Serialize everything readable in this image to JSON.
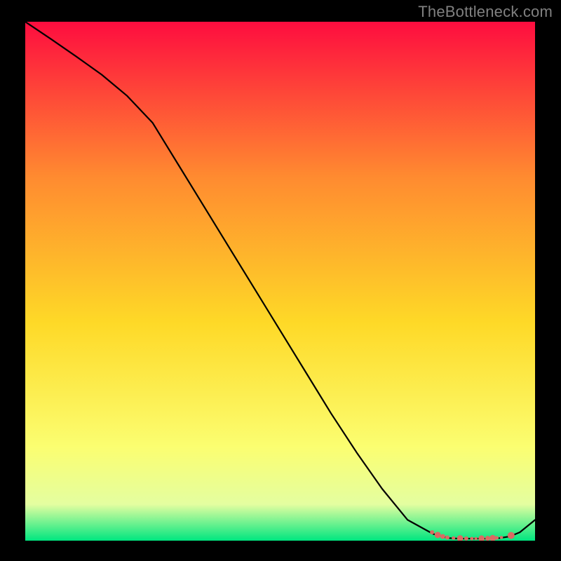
{
  "watermark": "TheBottleneck.com",
  "chart_data": {
    "type": "line",
    "title": "",
    "xlabel": "",
    "ylabel": "",
    "xlim": [
      0,
      100
    ],
    "ylim": [
      0,
      100
    ],
    "gradient": {
      "top": "#fe0d3f",
      "mid_upper": "#ff8b30",
      "mid": "#fed927",
      "mid_lower": "#fbfe71",
      "lower": "#e4fea0",
      "bottom": "#00e680"
    },
    "series": [
      {
        "name": "bottleneck-curve",
        "stroke": "#000000",
        "x": [
          0,
          5,
          10,
          15,
          20,
          25,
          30,
          35,
          40,
          45,
          50,
          55,
          60,
          65,
          70,
          75,
          80,
          83,
          85,
          87,
          89,
          91,
          93,
          95,
          97,
          100
        ],
        "y": [
          100,
          96.7,
          93.3,
          89.8,
          85.7,
          80.5,
          72.5,
          64.5,
          56.5,
          48.5,
          40.5,
          32.5,
          24.5,
          17.0,
          10.0,
          4.0,
          1.3,
          0.5,
          0.4,
          0.4,
          0.4,
          0.4,
          0.5,
          0.8,
          1.6,
          4.0
        ]
      }
    ],
    "markers": {
      "name": "bottom-dots",
      "fill": "#d96b63",
      "points": [
        {
          "x": 79.8,
          "y": 1.6,
          "r": 3.0
        },
        {
          "x": 80.9,
          "y": 1.1,
          "r": 4.5
        },
        {
          "x": 81.9,
          "y": 0.8,
          "r": 3.5
        },
        {
          "x": 82.8,
          "y": 0.6,
          "r": 3.0
        },
        {
          "x": 84.0,
          "y": 0.5,
          "r": 2.6
        },
        {
          "x": 85.3,
          "y": 0.45,
          "r": 4.5
        },
        {
          "x": 86.5,
          "y": 0.42,
          "r": 3.0
        },
        {
          "x": 87.6,
          "y": 0.4,
          "r": 2.6
        },
        {
          "x": 88.4,
          "y": 0.4,
          "r": 2.3
        },
        {
          "x": 89.5,
          "y": 0.42,
          "r": 4.5
        },
        {
          "x": 90.7,
          "y": 0.46,
          "r": 3.5
        },
        {
          "x": 91.7,
          "y": 0.5,
          "r": 4.5
        },
        {
          "x": 92.5,
          "y": 0.55,
          "r": 2.6
        },
        {
          "x": 93.4,
          "y": 0.62,
          "r": 2.3
        },
        {
          "x": 95.3,
          "y": 1.0,
          "r": 5.0
        }
      ]
    }
  }
}
